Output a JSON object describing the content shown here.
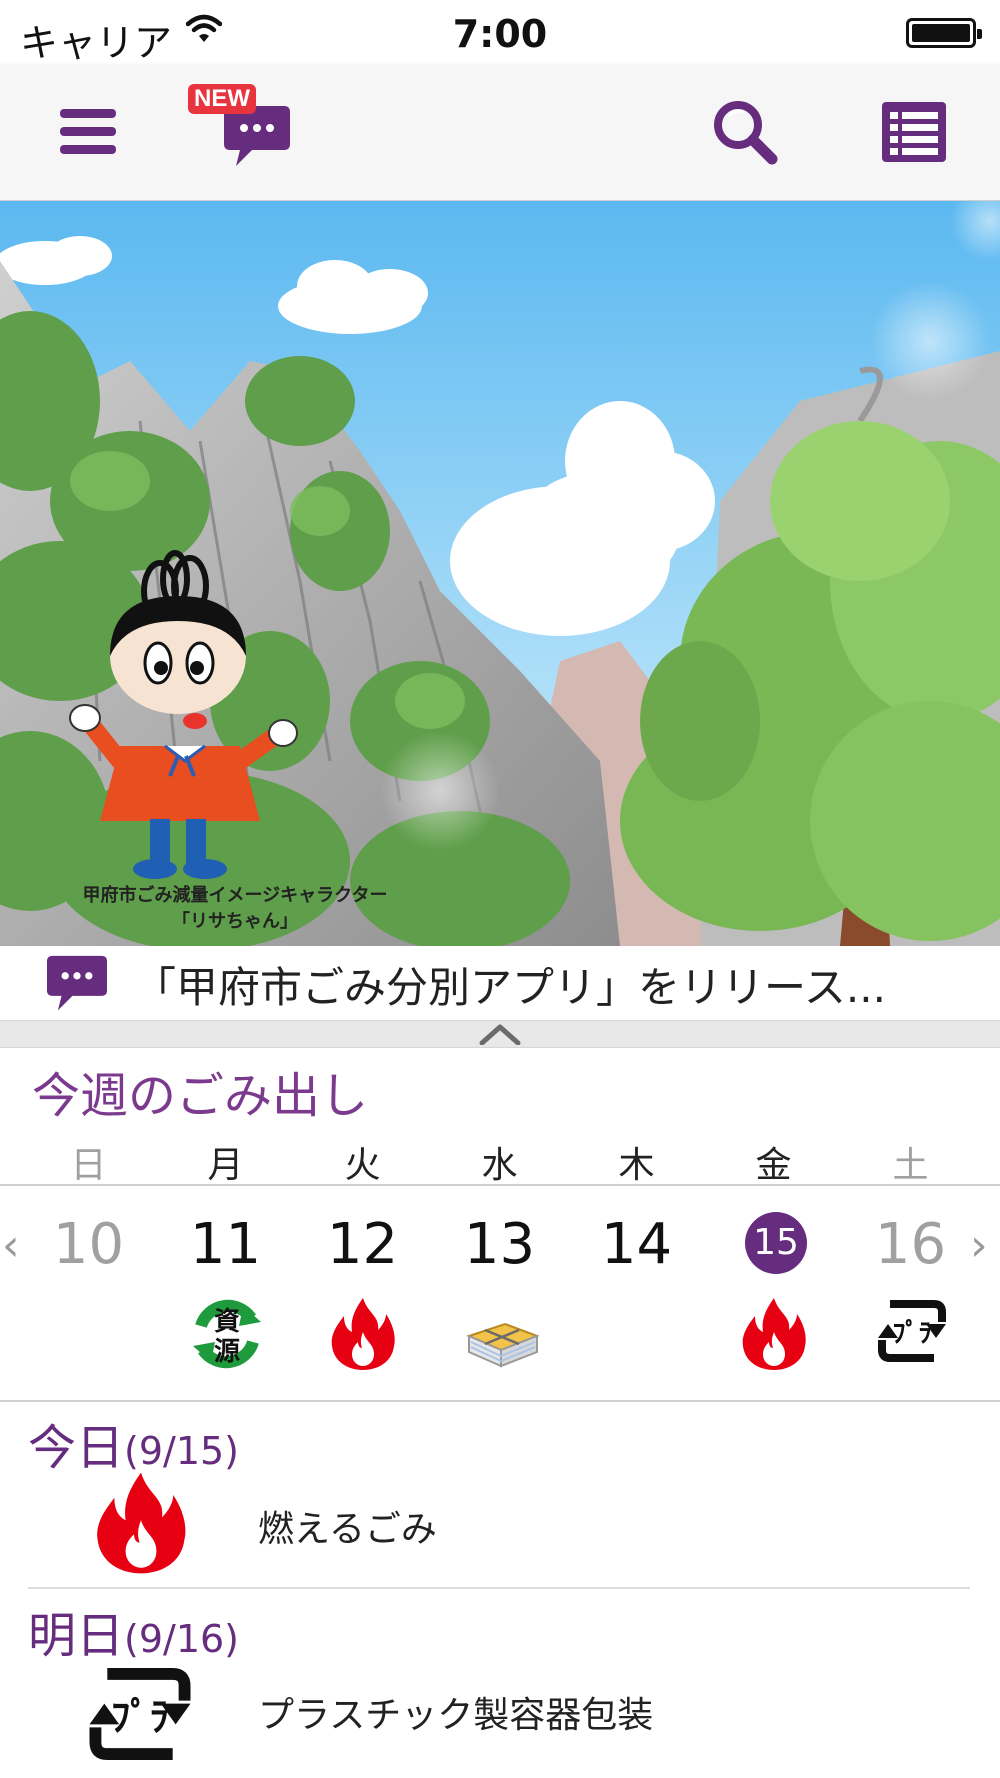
{
  "status_bar": {
    "carrier": "キャリア",
    "time": "7:00"
  },
  "toolbar": {
    "new_badge": "NEW"
  },
  "hero": {
    "caption_line1": "甲府市ごみ減量イメージキャラクター",
    "caption_line2": "「リサちゃん」"
  },
  "news": {
    "text": "「甲府市ごみ分別アプリ」をリリース..."
  },
  "week": {
    "title": "今週のごみ出し",
    "weekdays": [
      "日",
      "月",
      "火",
      "水",
      "木",
      "金",
      "土"
    ],
    "dates": [
      "10",
      "11",
      "12",
      "13",
      "14",
      "15",
      "16"
    ],
    "today_index": 5,
    "icons": [
      "",
      "resource-recycle-icon",
      "burnable-flame-icon",
      "paper-bundle-icon",
      "",
      "burnable-flame-icon",
      "plastic-recycle-icon"
    ],
    "prev_arrow": "‹",
    "next_arrow": "›"
  },
  "today": {
    "label": "今日",
    "date": "(9/15)",
    "type": "燃えるごみ",
    "icon": "burnable-flame-icon"
  },
  "tomorrow": {
    "label": "明日",
    "date": "(9/16)",
    "type": "プラスチック製容器包装",
    "icon": "plastic-recycle-icon"
  },
  "colors": {
    "accent": "#662d7f",
    "title": "#7b3a8e",
    "flame": "#e60012",
    "badge": "#e8343e",
    "recycle_green": "#1e9b3c"
  }
}
